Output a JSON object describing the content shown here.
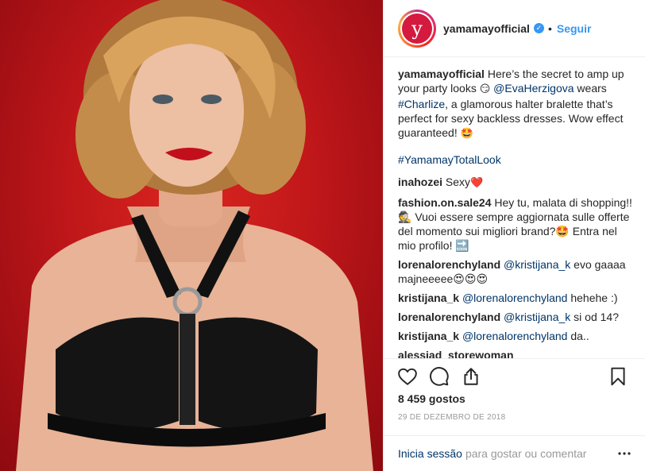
{
  "header": {
    "username": "yamamayofficial",
    "avatar_letter": "y",
    "separator": "•",
    "follow_label": "Seguir"
  },
  "caption": {
    "username": "yamamayofficial",
    "text_1": " Here’s the secret to amp up your party looks ",
    "emoji_1": "😏",
    "mention": "@EvaHerzigova",
    "text_2": " wears ",
    "tag_1": "#Charlize",
    "text_3": ", a glamorous halter bralette that’s perfect for sexy backless dresses. Wow effect guaranteed! ",
    "emoji_2": "🤩",
    "tag_2": "#YamamayTotalLook"
  },
  "comments": [
    {
      "username": "inahozei",
      "text": " Sexy",
      "emoji": "❤️"
    },
    {
      "username": "fashion.on.sale24",
      "text": " Hey tu, malata di shopping!! 🕵 Vuoi essere sempre aggiornata sulle offerte del momento sui migliori brand?🤩 Entra nel mio profilo! 🔜"
    },
    {
      "username": "lorenalorenchyland",
      "mention": " @kristijana_k",
      "text": " evo gaaaa majneeeee😍😍😍"
    },
    {
      "username": "kristijana_k",
      "mention": " @lorenalorenchyland",
      "text": " hehehe :)"
    },
    {
      "username": "lorenalorenchyland",
      "mention": " @kristijana_k",
      "text": " si od 14?"
    },
    {
      "username": "kristijana_k",
      "mention": " @lorenalorenchyland",
      "text": " da.."
    },
    {
      "username": "alessiad_storewoman",
      "text": ""
    }
  ],
  "actions": {
    "like_icon": "heart-icon",
    "comment_icon": "comment-icon",
    "share_icon": "share-icon",
    "save_icon": "bookmark-icon"
  },
  "likes": "8 459 gostos",
  "date": "29 DE DEZEMBRO DE 2018",
  "footer": {
    "login_label": "Inicia sessão",
    "rest_text": "para gostar ou comentar",
    "more_icon": "more-icon"
  },
  "colors": {
    "link_blue": "#3897f0",
    "tag_blue": "#003569",
    "background_red": "#c0171a"
  }
}
